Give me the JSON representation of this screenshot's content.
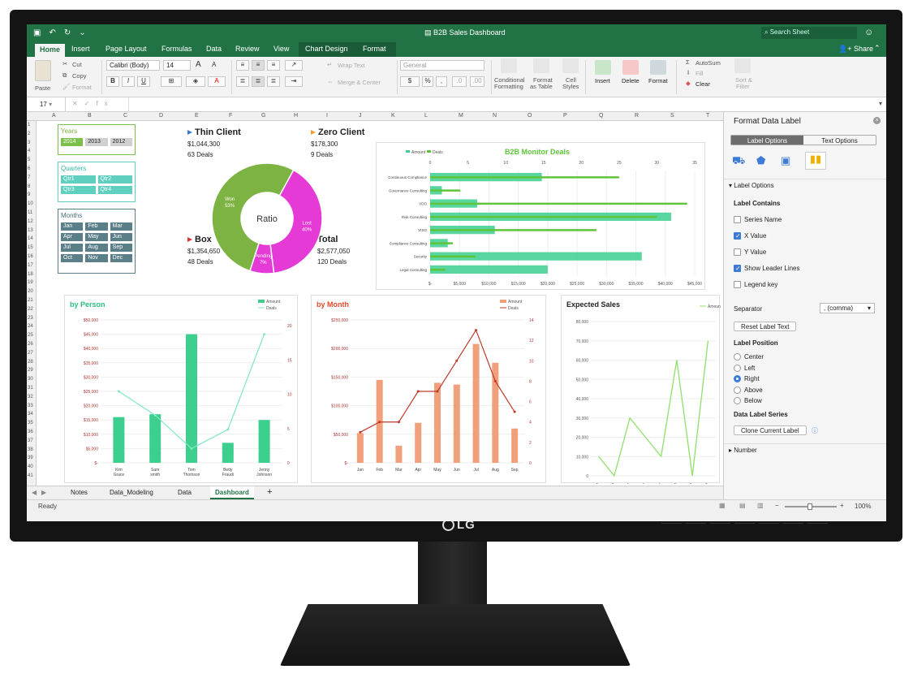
{
  "title_bar": {
    "document_title": "B2B Sales Dashboard",
    "search_placeholder": "Search Sheet"
  },
  "ribbon_tabs": [
    "Home",
    "Insert",
    "Page Layout",
    "Formulas",
    "Data",
    "Review",
    "View",
    "Chart Design",
    "Format"
  ],
  "ribbon_share": "Share",
  "ribbon": {
    "paste": "Paste",
    "cut": "Cut",
    "copy": "Copy",
    "format_painter": "Format",
    "font": "Calibri (Body)",
    "size": "14",
    "bold": "B",
    "italic": "I",
    "underline": "U",
    "grow": "A",
    "shrink": "A",
    "wrap_text": "Wrap Text",
    "merge_center": "Merge & Center",
    "number_format": "General",
    "cond_format": "Conditional",
    "cond_format2": "Formatting",
    "format_table": "Format",
    "format_table2": "as Table",
    "cell_styles": "Cell",
    "cell_styles2": "Styles",
    "insert": "Insert",
    "delete": "Delete",
    "format": "Format",
    "autosum": "AutoSum",
    "fill": "Fill",
    "clear": "Clear",
    "sort_filter": "Sort &",
    "sort_filter2": "Filter"
  },
  "formula_bar": {
    "cell_ref": "17",
    "fx": "fx"
  },
  "columns": [
    "A",
    "B",
    "C",
    "D",
    "E",
    "F",
    "G",
    "H",
    "I",
    "J",
    "K",
    "L",
    "M",
    "N",
    "O",
    "P",
    "Q",
    "R",
    "S",
    "T"
  ],
  "rows": [
    "1",
    "2",
    "3",
    "4",
    "5",
    "6",
    "7",
    "8",
    "9",
    "10",
    "11",
    "12",
    "13",
    "14",
    "15",
    "16",
    "17",
    "18",
    "19",
    "20",
    "21",
    "22",
    "23",
    "24",
    "25",
    "26",
    "27",
    "28",
    "29",
    "30",
    "31",
    "32",
    "33",
    "34",
    "35",
    "36",
    "37",
    "38",
    "39",
    "40",
    "41"
  ],
  "slicers": {
    "years": {
      "title": "Years",
      "items": [
        "2014",
        "2013",
        "2012"
      ],
      "selected": "2014"
    },
    "quarters": {
      "title": "Quarters",
      "items": [
        "Qtr1",
        "Qtr2",
        "Qtr3",
        "Qtr4"
      ]
    },
    "months": {
      "title": "Months",
      "items": [
        "Jan",
        "Feb",
        "Mar",
        "Apr",
        "May",
        "Jun",
        "Jul",
        "Aug",
        "Sep",
        "Oct",
        "Nov",
        "Dec"
      ]
    }
  },
  "kpis": {
    "thin_client": {
      "title": "Thin Client",
      "value": "$1,044,300",
      "deals": "63 Deals"
    },
    "zero_client": {
      "title": "Zero Client",
      "value": "$178,300",
      "deals": "9 Deals"
    },
    "box": {
      "title": "Box",
      "value": "$1,354,650",
      "deals": "48 Deals"
    },
    "total": {
      "title": "Total",
      "value": "$2,577,050",
      "deals": "120 Deals"
    }
  },
  "colors": {
    "green_excel": "#217346",
    "teal": "#3ccf8e",
    "salmon": "#f0a07a",
    "magenta": "#e63ad6",
    "olive": "#7cb342",
    "light_green": "#8ee06a"
  },
  "chart_data": [
    {
      "type": "pie",
      "title": "Ratio",
      "categories": [
        "Won",
        "Lost",
        "Pending"
      ],
      "values": [
        53,
        40,
        7
      ],
      "labels": [
        "Won 53%",
        "Lost 40%",
        "Pending 7%"
      ]
    },
    {
      "type": "bar",
      "title": "B2B Monitor Deals",
      "categories": [
        "Continuous Compliance",
        "Governance Consulting",
        "VDO",
        "Risk Consulting",
        "VISO",
        "Compliance Consulting",
        "Security",
        "Legal Consulting"
      ],
      "series": [
        {
          "name": "Amount",
          "values": [
            19000,
            2000,
            8000,
            41000,
            11000,
            3000,
            36000,
            20000
          ]
        },
        {
          "name": "Deals",
          "values": [
            25,
            4,
            34,
            30,
            22,
            3,
            6,
            2
          ]
        }
      ],
      "x_ticks_amount": [
        "$-",
        "$5,000",
        "$10,000",
        "$15,000",
        "$20,000",
        "$25,000",
        "$30,000",
        "$35,000",
        "$40,000",
        "$45,000"
      ],
      "x_ticks_deals": [
        "0",
        "5",
        "10",
        "15",
        "20",
        "25",
        "30",
        "35"
      ]
    },
    {
      "type": "bar",
      "title": "by Person",
      "categories": [
        "Kim Grace",
        "Sam smith",
        "Tom Thomson",
        "Betty Fraudi",
        "Jenny Johnson"
      ],
      "series": [
        {
          "name": "Amount",
          "values": [
            16000,
            17000,
            45000,
            7000,
            15000
          ]
        },
        {
          "name": "Deals",
          "values": [
            15,
            10,
            3,
            7,
            27
          ]
        }
      ],
      "y_ticks": [
        "$-",
        "$5,000",
        "$10,000",
        "$15,000",
        "$20,000",
        "$25,000",
        "$30,000",
        "$35,000",
        "$40,000",
        "$45,000",
        "$50,000"
      ],
      "y2_ticks": [
        "0",
        "5",
        "10",
        "15",
        "20",
        "25"
      ]
    },
    {
      "type": "bar",
      "title": "by Month",
      "categories": [
        "Jan",
        "Feb",
        "Mar",
        "Apr",
        "May",
        "Jun",
        "Jul",
        "Aug",
        "Sep"
      ],
      "series": [
        {
          "name": "Amount",
          "values": [
            52000,
            145000,
            30000,
            70000,
            140000,
            137000,
            208000,
            175000,
            60000
          ]
        },
        {
          "name": "Deals",
          "values": [
            3,
            4,
            4,
            7,
            7,
            10,
            13,
            8,
            5
          ]
        }
      ],
      "y_ticks": [
        "$-",
        "$50,000",
        "$100,000",
        "$150,000",
        "$200,000",
        "$250,000"
      ],
      "y2_ticks": [
        "0",
        "2",
        "4",
        "6",
        "8",
        "10",
        "12",
        "14"
      ]
    },
    {
      "type": "line",
      "title": "Expected Sales",
      "categories": [
        "Jan",
        "Feb",
        "Mar",
        "Apr",
        "May",
        "Jun",
        "Jul",
        "Aug",
        "Sep"
      ],
      "series": [
        {
          "name": "Amount",
          "values": [
            10000,
            0,
            30000,
            20000,
            10000,
            60000,
            0,
            70000
          ]
        }
      ],
      "y_ticks": [
        "0",
        "10,000",
        "20,000",
        "30,000",
        "40,000",
        "50,000",
        "60,000",
        "70,000",
        "80,000"
      ]
    }
  ],
  "sheet_tabs": [
    "Notes",
    "Data_Modeling",
    "Data",
    "Dashboard"
  ],
  "active_sheet": "Dashboard",
  "status": {
    "ready": "Ready",
    "zoom": "100%"
  },
  "panel": {
    "title": "Format Data Label",
    "tabs": [
      "Label Options",
      "Text Options"
    ],
    "section_label_options": "Label Options",
    "label_contains": "Label Contains",
    "checkboxes": [
      {
        "label": "Series Name",
        "checked": false
      },
      {
        "label": "X Value",
        "checked": true
      },
      {
        "label": "Y Value",
        "checked": false
      },
      {
        "label": "Show Leader Lines",
        "checked": true
      },
      {
        "label": "Legend key",
        "checked": false
      }
    ],
    "separator_label": "Separator",
    "separator_value": ", (comma)",
    "reset_button": "Reset Label Text",
    "label_position": "Label Position",
    "positions": [
      {
        "label": "Center",
        "selected": false
      },
      {
        "label": "Left",
        "selected": false
      },
      {
        "label": "Right",
        "selected": true
      },
      {
        "label": "Above",
        "selected": false
      },
      {
        "label": "Below",
        "selected": false
      }
    ],
    "data_label_series": "Data Label Series",
    "clone_button": "Clone Current Label",
    "section_number": "Number"
  },
  "brand": "LG"
}
